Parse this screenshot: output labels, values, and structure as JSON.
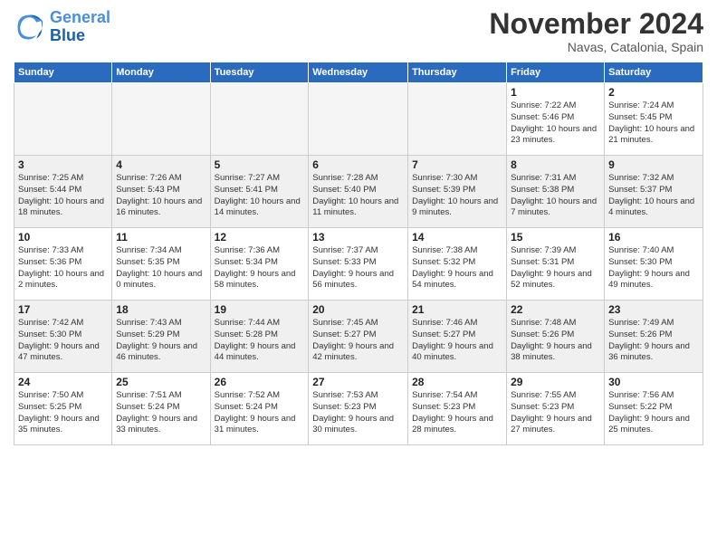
{
  "header": {
    "logo_line1": "General",
    "logo_line2": "Blue",
    "month": "November 2024",
    "location": "Navas, Catalonia, Spain"
  },
  "days_of_week": [
    "Sunday",
    "Monday",
    "Tuesday",
    "Wednesday",
    "Thursday",
    "Friday",
    "Saturday"
  ],
  "weeks": [
    [
      {
        "day": "",
        "empty": true
      },
      {
        "day": "",
        "empty": true
      },
      {
        "day": "",
        "empty": true
      },
      {
        "day": "",
        "empty": true
      },
      {
        "day": "",
        "empty": true
      },
      {
        "day": "1",
        "sunrise": "7:22 AM",
        "sunset": "5:46 PM",
        "daylight": "10 hours and 23 minutes."
      },
      {
        "day": "2",
        "sunrise": "7:24 AM",
        "sunset": "5:45 PM",
        "daylight": "10 hours and 21 minutes."
      }
    ],
    [
      {
        "day": "3",
        "sunrise": "7:25 AM",
        "sunset": "5:44 PM",
        "daylight": "10 hours and 18 minutes."
      },
      {
        "day": "4",
        "sunrise": "7:26 AM",
        "sunset": "5:43 PM",
        "daylight": "10 hours and 16 minutes."
      },
      {
        "day": "5",
        "sunrise": "7:27 AM",
        "sunset": "5:41 PM",
        "daylight": "10 hours and 14 minutes."
      },
      {
        "day": "6",
        "sunrise": "7:28 AM",
        "sunset": "5:40 PM",
        "daylight": "10 hours and 11 minutes."
      },
      {
        "day": "7",
        "sunrise": "7:30 AM",
        "sunset": "5:39 PM",
        "daylight": "10 hours and 9 minutes."
      },
      {
        "day": "8",
        "sunrise": "7:31 AM",
        "sunset": "5:38 PM",
        "daylight": "10 hours and 7 minutes."
      },
      {
        "day": "9",
        "sunrise": "7:32 AM",
        "sunset": "5:37 PM",
        "daylight": "10 hours and 4 minutes."
      }
    ],
    [
      {
        "day": "10",
        "sunrise": "7:33 AM",
        "sunset": "5:36 PM",
        "daylight": "10 hours and 2 minutes."
      },
      {
        "day": "11",
        "sunrise": "7:34 AM",
        "sunset": "5:35 PM",
        "daylight": "10 hours and 0 minutes."
      },
      {
        "day": "12",
        "sunrise": "7:36 AM",
        "sunset": "5:34 PM",
        "daylight": "9 hours and 58 minutes."
      },
      {
        "day": "13",
        "sunrise": "7:37 AM",
        "sunset": "5:33 PM",
        "daylight": "9 hours and 56 minutes."
      },
      {
        "day": "14",
        "sunrise": "7:38 AM",
        "sunset": "5:32 PM",
        "daylight": "9 hours and 54 minutes."
      },
      {
        "day": "15",
        "sunrise": "7:39 AM",
        "sunset": "5:31 PM",
        "daylight": "9 hours and 52 minutes."
      },
      {
        "day": "16",
        "sunrise": "7:40 AM",
        "sunset": "5:30 PM",
        "daylight": "9 hours and 49 minutes."
      }
    ],
    [
      {
        "day": "17",
        "sunrise": "7:42 AM",
        "sunset": "5:30 PM",
        "daylight": "9 hours and 47 minutes."
      },
      {
        "day": "18",
        "sunrise": "7:43 AM",
        "sunset": "5:29 PM",
        "daylight": "9 hours and 46 minutes."
      },
      {
        "day": "19",
        "sunrise": "7:44 AM",
        "sunset": "5:28 PM",
        "daylight": "9 hours and 44 minutes."
      },
      {
        "day": "20",
        "sunrise": "7:45 AM",
        "sunset": "5:27 PM",
        "daylight": "9 hours and 42 minutes."
      },
      {
        "day": "21",
        "sunrise": "7:46 AM",
        "sunset": "5:27 PM",
        "daylight": "9 hours and 40 minutes."
      },
      {
        "day": "22",
        "sunrise": "7:48 AM",
        "sunset": "5:26 PM",
        "daylight": "9 hours and 38 minutes."
      },
      {
        "day": "23",
        "sunrise": "7:49 AM",
        "sunset": "5:26 PM",
        "daylight": "9 hours and 36 minutes."
      }
    ],
    [
      {
        "day": "24",
        "sunrise": "7:50 AM",
        "sunset": "5:25 PM",
        "daylight": "9 hours and 35 minutes."
      },
      {
        "day": "25",
        "sunrise": "7:51 AM",
        "sunset": "5:24 PM",
        "daylight": "9 hours and 33 minutes."
      },
      {
        "day": "26",
        "sunrise": "7:52 AM",
        "sunset": "5:24 PM",
        "daylight": "9 hours and 31 minutes."
      },
      {
        "day": "27",
        "sunrise": "7:53 AM",
        "sunset": "5:23 PM",
        "daylight": "9 hours and 30 minutes."
      },
      {
        "day": "28",
        "sunrise": "7:54 AM",
        "sunset": "5:23 PM",
        "daylight": "9 hours and 28 minutes."
      },
      {
        "day": "29",
        "sunrise": "7:55 AM",
        "sunset": "5:23 PM",
        "daylight": "9 hours and 27 minutes."
      },
      {
        "day": "30",
        "sunrise": "7:56 AM",
        "sunset": "5:22 PM",
        "daylight": "9 hours and 25 minutes."
      }
    ]
  ]
}
